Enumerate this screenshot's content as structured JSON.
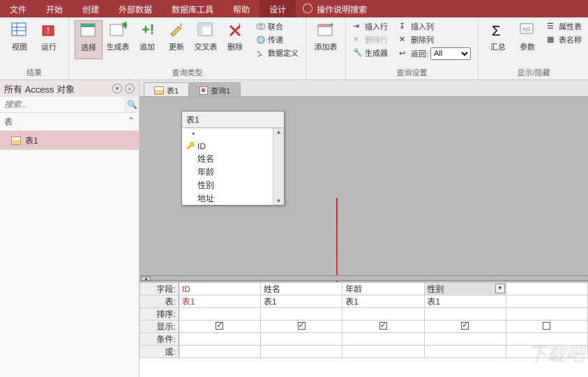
{
  "menubar": {
    "items": [
      "文件",
      "开始",
      "创建",
      "外部数据",
      "数据库工具",
      "帮助",
      "设计"
    ],
    "active": 6,
    "tell_me": "操作说明搜索"
  },
  "ribbon": {
    "results": {
      "label": "结果",
      "view": "视图",
      "run": "运行"
    },
    "qtype": {
      "label": "查询类型",
      "select": "选择",
      "maketable": "生成表",
      "append": "追加",
      "update": "更新",
      "crosstab": "交叉表",
      "delete": "删除",
      "union": "联合",
      "passthrough": "传递",
      "datadef": "数据定义"
    },
    "addtable": {
      "add": "添加表"
    },
    "qsetup": {
      "label": "查询设置",
      "insertrow": "插入行",
      "deleterow": "删除行",
      "builder": "生成器",
      "insertcol": "插入列",
      "deletecol": "删除列",
      "return": "返回:",
      "return_val": "All"
    },
    "showhide": {
      "label": "显示/隐藏",
      "totals": "汇总",
      "params": "参数",
      "propsheet": "属性表",
      "tablenames": "表名称"
    }
  },
  "nav": {
    "title": "所有 Access 对象",
    "search_ph": "搜索...",
    "cat": "表",
    "items": [
      {
        "name": "表1"
      }
    ]
  },
  "tabs": [
    {
      "label": "表1",
      "type": "table"
    },
    {
      "label": "查询1",
      "type": "query",
      "active": true
    }
  ],
  "tablebox": {
    "name": "表1",
    "fields": [
      "*",
      "ID",
      "姓名",
      "年龄",
      "性别",
      "地址"
    ],
    "pk_index": 1
  },
  "grid": {
    "labels": {
      "field": "字段:",
      "table": "表:",
      "sort": "排序:",
      "show": "显示:",
      "criteria": "条件:",
      "or": "或:"
    },
    "cols": [
      {
        "field": "ID",
        "table": "表1",
        "show": true
      },
      {
        "field": "姓名",
        "table": "表1",
        "show": true
      },
      {
        "field": "年龄",
        "table": "表1",
        "show": true
      },
      {
        "field": "性别",
        "table": "表1",
        "show": true,
        "selected": true
      },
      {
        "field": "",
        "table": "",
        "show": false
      }
    ]
  },
  "watermark": "下载吧"
}
